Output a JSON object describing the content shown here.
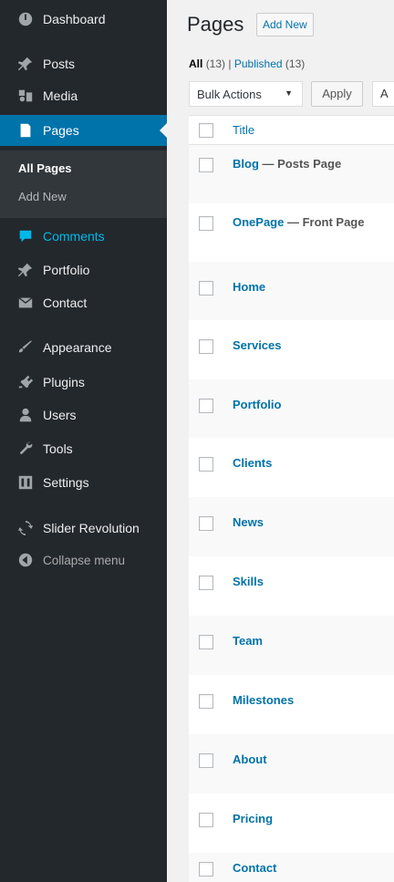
{
  "sidebar": {
    "items": [
      {
        "label": "Dashboard",
        "icon": "dashboard-icon"
      },
      {
        "label": "Posts",
        "icon": "pin-icon"
      },
      {
        "label": "Media",
        "icon": "media-icon"
      },
      {
        "label": "Pages",
        "icon": "page-icon",
        "current": true
      },
      {
        "label": "Comments",
        "icon": "comment-icon"
      },
      {
        "label": "Portfolio",
        "icon": "pin-icon"
      },
      {
        "label": "Contact",
        "icon": "mail-icon"
      },
      {
        "label": "Appearance",
        "icon": "brush-icon"
      },
      {
        "label": "Plugins",
        "icon": "plugin-icon"
      },
      {
        "label": "Users",
        "icon": "user-icon"
      },
      {
        "label": "Tools",
        "icon": "wrench-icon"
      },
      {
        "label": "Settings",
        "icon": "settings-icon"
      },
      {
        "label": "Slider Revolution",
        "icon": "refresh-icon"
      },
      {
        "label": "Collapse menu",
        "icon": "collapse-icon"
      }
    ],
    "submenu": {
      "all_pages": "All Pages",
      "add_new": "Add New"
    }
  },
  "header": {
    "title": "Pages",
    "add_new": "Add New"
  },
  "filters": {
    "all_label": "All",
    "all_count": "(13)",
    "separator": "|",
    "published_label": "Published",
    "published_count": "(13)"
  },
  "bulk": {
    "select_value": "Bulk Actions",
    "caret": "▼",
    "apply": "Apply",
    "next_control": "A"
  },
  "table": {
    "column_title": "Title",
    "rows": [
      {
        "title": "Blog",
        "state": " — Posts Page"
      },
      {
        "title": "OnePage",
        "state": " — Front Page"
      },
      {
        "title": "Home",
        "state": ""
      },
      {
        "title": "Services",
        "state": ""
      },
      {
        "title": "Portfolio",
        "state": ""
      },
      {
        "title": "Clients",
        "state": ""
      },
      {
        "title": "News",
        "state": ""
      },
      {
        "title": "Skills",
        "state": ""
      },
      {
        "title": "Team",
        "state": ""
      },
      {
        "title": "Milestones",
        "state": ""
      },
      {
        "title": "About",
        "state": ""
      },
      {
        "title": "Pricing",
        "state": ""
      },
      {
        "title": "Contact",
        "state": ""
      }
    ]
  },
  "colors": {
    "sidebar_bg": "#23282d",
    "accent": "#0073aa",
    "highlight": "#00b9eb"
  }
}
